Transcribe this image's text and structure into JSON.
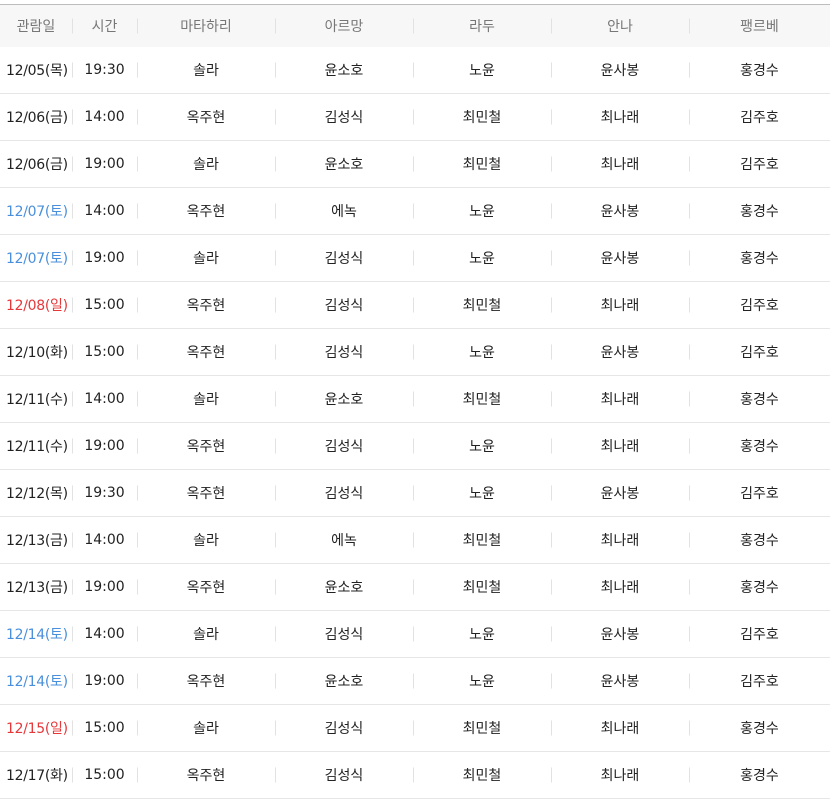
{
  "columns": [
    "관람일",
    "시간",
    "마타하리",
    "아르망",
    "라두",
    "안나",
    "팽르베"
  ],
  "colors": {
    "saturday": "#4a8fdb",
    "sunday": "#e5383b",
    "weekday": "#222222"
  },
  "rows": [
    {
      "date": "12/05(목)",
      "day_type": "weekday",
      "time": "19:30",
      "matahari": "솔라",
      "armand": "윤소호",
      "ladoux": "노윤",
      "anna": "윤사봉",
      "painleve": "홍경수"
    },
    {
      "date": "12/06(금)",
      "day_type": "weekday",
      "time": "14:00",
      "matahari": "옥주현",
      "armand": "김성식",
      "ladoux": "최민철",
      "anna": "최나래",
      "painleve": "김주호"
    },
    {
      "date": "12/06(금)",
      "day_type": "weekday",
      "time": "19:00",
      "matahari": "솔라",
      "armand": "윤소호",
      "ladoux": "최민철",
      "anna": "최나래",
      "painleve": "김주호"
    },
    {
      "date": "12/07(토)",
      "day_type": "saturday",
      "time": "14:00",
      "matahari": "옥주현",
      "armand": "에녹",
      "ladoux": "노윤",
      "anna": "윤사봉",
      "painleve": "홍경수"
    },
    {
      "date": "12/07(토)",
      "day_type": "saturday",
      "time": "19:00",
      "matahari": "솔라",
      "armand": "김성식",
      "ladoux": "노윤",
      "anna": "윤사봉",
      "painleve": "홍경수"
    },
    {
      "date": "12/08(일)",
      "day_type": "sunday",
      "time": "15:00",
      "matahari": "옥주현",
      "armand": "김성식",
      "ladoux": "최민철",
      "anna": "최나래",
      "painleve": "김주호"
    },
    {
      "date": "12/10(화)",
      "day_type": "weekday",
      "time": "15:00",
      "matahari": "옥주현",
      "armand": "김성식",
      "ladoux": "노윤",
      "anna": "윤사봉",
      "painleve": "김주호"
    },
    {
      "date": "12/11(수)",
      "day_type": "weekday",
      "time": "14:00",
      "matahari": "솔라",
      "armand": "윤소호",
      "ladoux": "최민철",
      "anna": "최나래",
      "painleve": "홍경수"
    },
    {
      "date": "12/11(수)",
      "day_type": "weekday",
      "time": "19:00",
      "matahari": "옥주현",
      "armand": "김성식",
      "ladoux": "노윤",
      "anna": "최나래",
      "painleve": "홍경수"
    },
    {
      "date": "12/12(목)",
      "day_type": "weekday",
      "time": "19:30",
      "matahari": "옥주현",
      "armand": "김성식",
      "ladoux": "노윤",
      "anna": "윤사봉",
      "painleve": "김주호"
    },
    {
      "date": "12/13(금)",
      "day_type": "weekday",
      "time": "14:00",
      "matahari": "솔라",
      "armand": "에녹",
      "ladoux": "최민철",
      "anna": "최나래",
      "painleve": "홍경수"
    },
    {
      "date": "12/13(금)",
      "day_type": "weekday",
      "time": "19:00",
      "matahari": "옥주현",
      "armand": "윤소호",
      "ladoux": "최민철",
      "anna": "최나래",
      "painleve": "홍경수"
    },
    {
      "date": "12/14(토)",
      "day_type": "saturday",
      "time": "14:00",
      "matahari": "솔라",
      "armand": "김성식",
      "ladoux": "노윤",
      "anna": "윤사봉",
      "painleve": "김주호"
    },
    {
      "date": "12/14(토)",
      "day_type": "saturday",
      "time": "19:00",
      "matahari": "옥주현",
      "armand": "윤소호",
      "ladoux": "노윤",
      "anna": "윤사봉",
      "painleve": "김주호"
    },
    {
      "date": "12/15(일)",
      "day_type": "sunday",
      "time": "15:00",
      "matahari": "솔라",
      "armand": "김성식",
      "ladoux": "최민철",
      "anna": "최나래",
      "painleve": "홍경수"
    },
    {
      "date": "12/17(화)",
      "day_type": "weekday",
      "time": "15:00",
      "matahari": "옥주현",
      "armand": "김성식",
      "ladoux": "최민철",
      "anna": "최나래",
      "painleve": "홍경수"
    }
  ]
}
